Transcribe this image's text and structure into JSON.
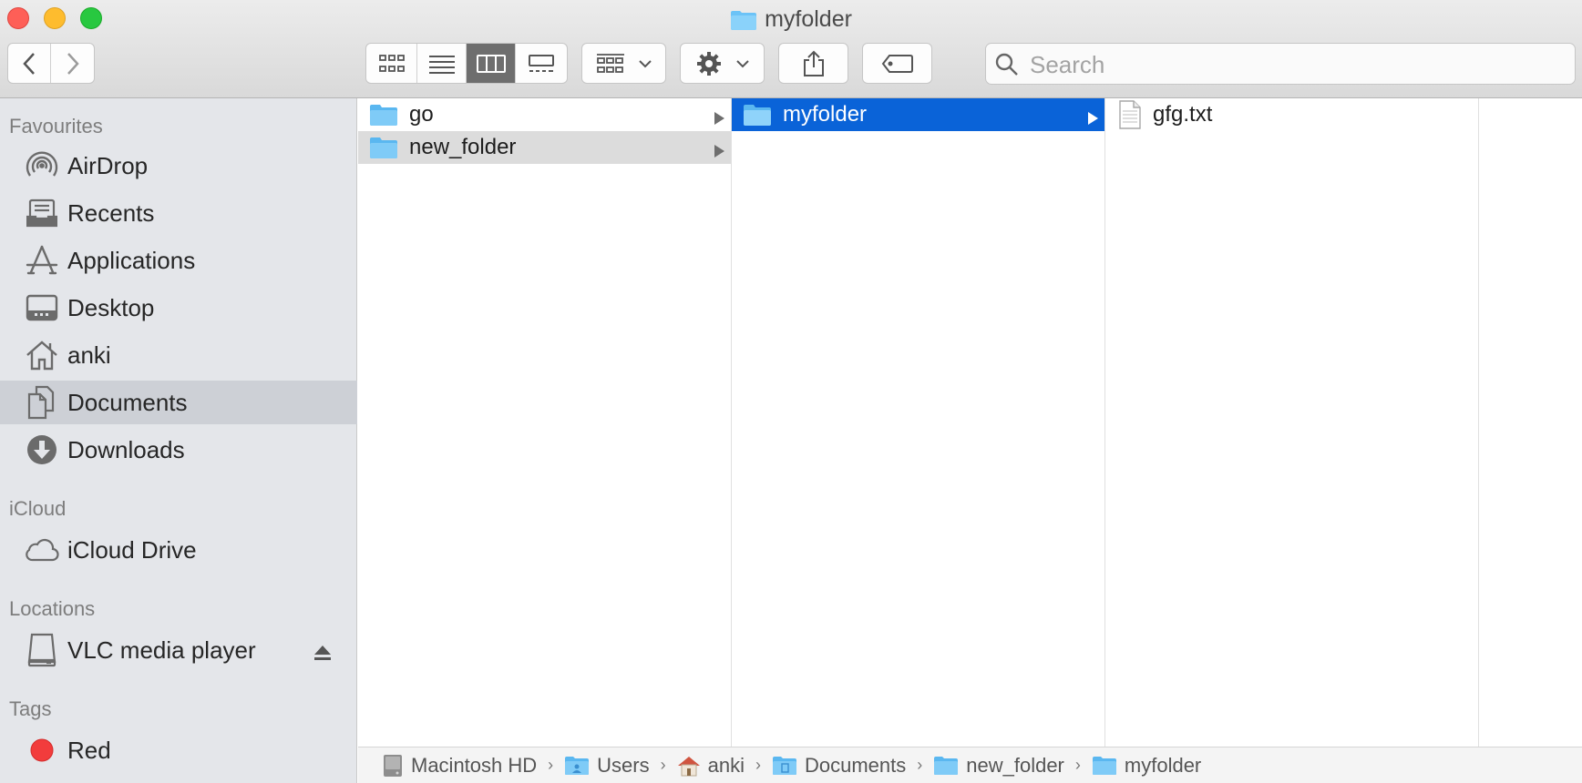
{
  "window": {
    "title": "myfolder"
  },
  "toolbar": {
    "back_icon": "chevron-left-icon",
    "forward_icon": "chevron-right-icon",
    "view_modes": [
      "icon-view",
      "list-view",
      "column-view",
      "gallery-view"
    ],
    "active_view": "column-view",
    "group_icon": "group-by-icon",
    "action_icon": "gear-icon",
    "share_icon": "share-icon",
    "tag_icon": "tag-icon",
    "search_placeholder": "Search"
  },
  "sidebar": {
    "favourites_label": "Favourites",
    "favourites": [
      {
        "label": "AirDrop",
        "icon": "airdrop-icon"
      },
      {
        "label": "Recents",
        "icon": "recents-icon"
      },
      {
        "label": "Applications",
        "icon": "applications-icon"
      },
      {
        "label": "Desktop",
        "icon": "desktop-icon"
      },
      {
        "label": "anki",
        "icon": "home-icon"
      },
      {
        "label": "Documents",
        "icon": "documents-icon",
        "selected": true
      },
      {
        "label": "Downloads",
        "icon": "downloads-icon"
      }
    ],
    "icloud_label": "iCloud",
    "icloud": [
      {
        "label": "iCloud Drive",
        "icon": "cloud-icon"
      }
    ],
    "locations_label": "Locations",
    "locations": [
      {
        "label": "VLC media player",
        "icon": "drive-icon",
        "ejectable": true
      }
    ],
    "tags_label": "Tags",
    "tags": [
      {
        "label": "Red",
        "color": "#f23c3c"
      }
    ]
  },
  "columns": [
    {
      "items": [
        {
          "name": "go",
          "type": "folder"
        },
        {
          "name": "new_folder",
          "type": "folder",
          "state": "open"
        }
      ]
    },
    {
      "items": [
        {
          "name": "myfolder",
          "type": "folder",
          "state": "selected"
        }
      ]
    },
    {
      "items": [
        {
          "name": "gfg.txt",
          "type": "file"
        }
      ]
    },
    {
      "items": []
    }
  ],
  "pathbar": [
    {
      "label": "Macintosh HD",
      "icon": "hard-disk-icon"
    },
    {
      "label": "Users",
      "icon": "users-folder-icon"
    },
    {
      "label": "anki",
      "icon": "home-icon"
    },
    {
      "label": "Documents",
      "icon": "documents-folder-icon"
    },
    {
      "label": "new_folder",
      "icon": "folder-icon"
    },
    {
      "label": "myfolder",
      "icon": "folder-icon"
    }
  ],
  "colors": {
    "folder": "#6cc3f7",
    "selection": "#0a63d8",
    "sidebar_selection": "#cdd0d6"
  }
}
